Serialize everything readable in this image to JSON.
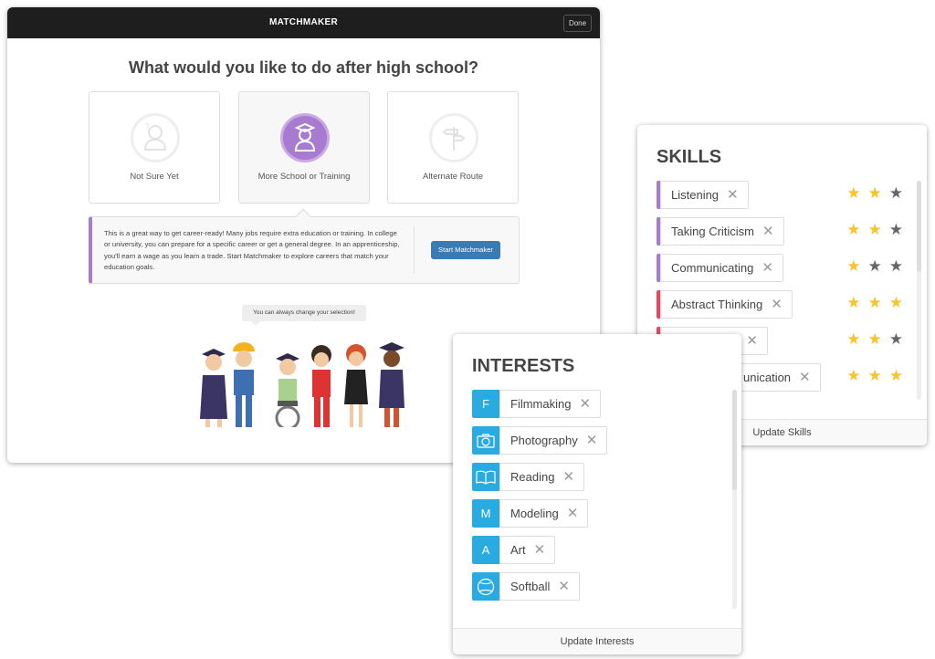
{
  "window": {
    "title": "MATCHMAKER",
    "done_label": "Done"
  },
  "question": "What would you like to do after high school?",
  "options": [
    {
      "label": "Not Sure Yet",
      "icon": "person-question-icon",
      "selected": false
    },
    {
      "label": "More School or Training",
      "icon": "graduate-icon",
      "selected": true
    },
    {
      "label": "Alternate Route",
      "icon": "signpost-icon",
      "selected": false
    }
  ],
  "info": {
    "text": "This is a great way to get career-ready! Many jobs require extra education or training. In college or university, you can prepare for a specific career or get a general degree. In an apprenticeship, you'll earn a wage as you learn a trade. Start Matchmaker to explore careers that match your education goals.",
    "button": "Start Matchmaker",
    "accent": "#a77bcf"
  },
  "bubble": "You can always change your selection!",
  "skills": {
    "title": "SKILLS",
    "footer": "Update Skills",
    "items": [
      {
        "label": "Listening",
        "color": "#a77bcf",
        "stars": 2
      },
      {
        "label": "Taking Criticism",
        "color": "#a77bcf",
        "stars": 2
      },
      {
        "label": "Communicating",
        "color": "#a77bcf",
        "stars": 1
      },
      {
        "label": "Abstract Thinking",
        "color": "#f0435a",
        "stars": 3
      },
      {
        "label": "",
        "color": "#f0435a",
        "stars": 2
      },
      {
        "label": "unication",
        "color": "#f0435a",
        "stars": 3
      }
    ]
  },
  "interests": {
    "title": "INTERESTS",
    "footer": "Update Interests",
    "items": [
      {
        "label": "Filmmaking",
        "icon": "F"
      },
      {
        "label": "Photography",
        "icon": "camera-icon"
      },
      {
        "label": "Reading",
        "icon": "book-icon"
      },
      {
        "label": "Modeling",
        "icon": "M"
      },
      {
        "label": "Art",
        "icon": "A"
      },
      {
        "label": "Softball",
        "icon": "softball-icon"
      }
    ]
  }
}
